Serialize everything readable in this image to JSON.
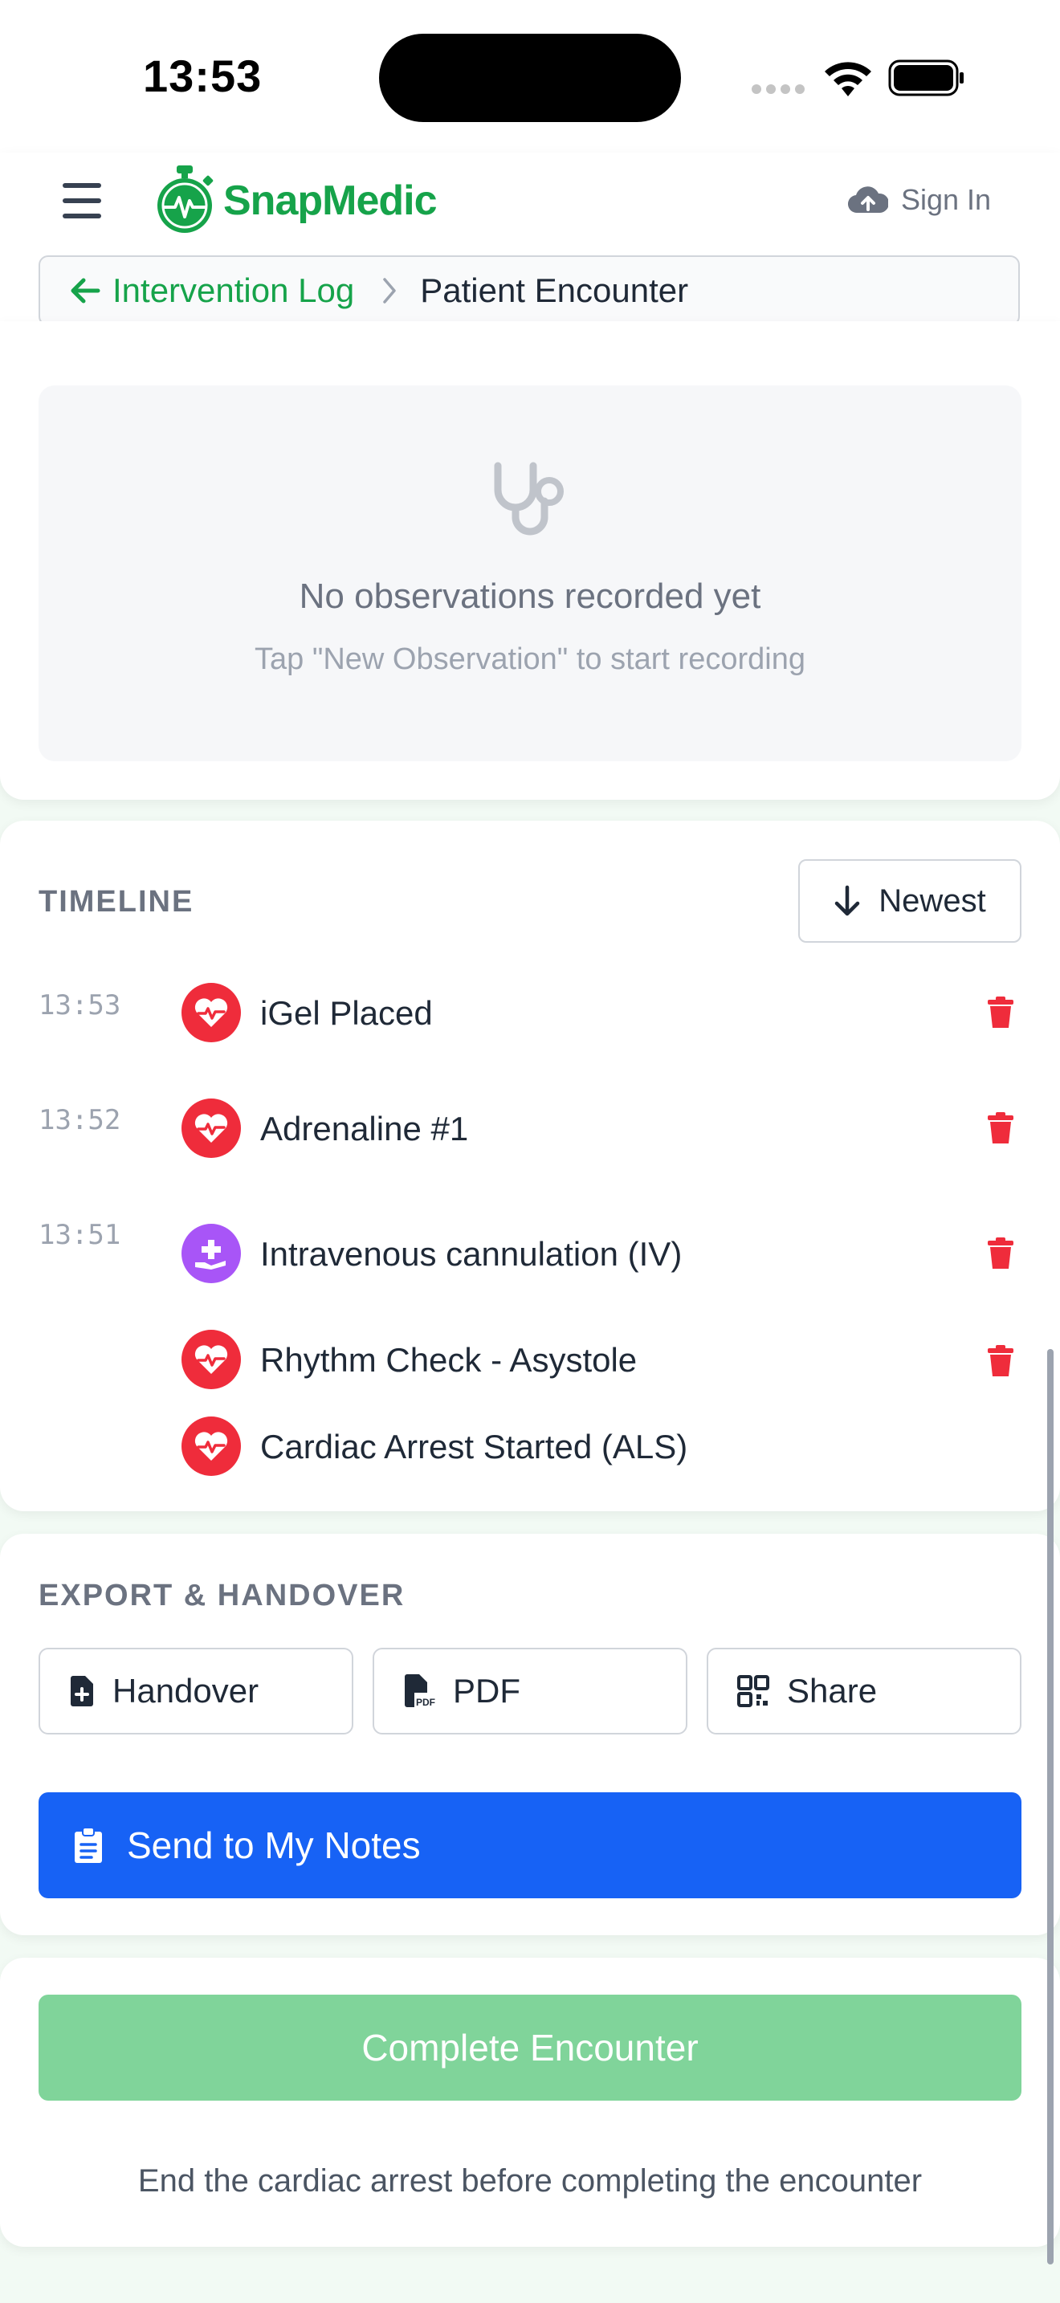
{
  "status_bar": {
    "time": "13:53"
  },
  "app": {
    "name": "SnapMedic",
    "sign_in": "Sign In",
    "colors": {
      "brand": "#16a34a",
      "danger": "#ef2c3b",
      "accent_purple": "#a855f7",
      "primary": "#1762f5",
      "disabled": "#80d49a"
    }
  },
  "breadcrumb": {
    "back": "Intervention Log",
    "current": "Patient Encounter"
  },
  "observations": {
    "empty_title": "No observations recorded yet",
    "empty_hint": "Tap \"New Observation\" to start recording"
  },
  "timeline": {
    "title": "TIMELINE",
    "sort_label": "Newest",
    "entries": [
      {
        "time": "13:53",
        "label": "iGel Placed",
        "icon": "heart-pulse-icon"
      },
      {
        "time": "13:52",
        "label": "Adrenaline #1",
        "icon": "heart-pulse-icon"
      },
      {
        "time": "13:51",
        "label": "Intravenous cannulation (IV)",
        "icon": "hand-medical-icon"
      },
      {
        "time": "",
        "label": "Rhythm Check - Asystole",
        "icon": "heart-pulse-icon"
      },
      {
        "time": "",
        "label": "Cardiac Arrest Started (ALS)",
        "icon": "heart-pulse-icon"
      }
    ]
  },
  "export": {
    "title": "EXPORT & HANDOVER",
    "handover": "Handover",
    "pdf": "PDF",
    "share": "Share",
    "send_notes": "Send to My Notes"
  },
  "complete": {
    "button": "Complete Encounter",
    "note": "End the cardiac arrest before completing the encounter"
  }
}
